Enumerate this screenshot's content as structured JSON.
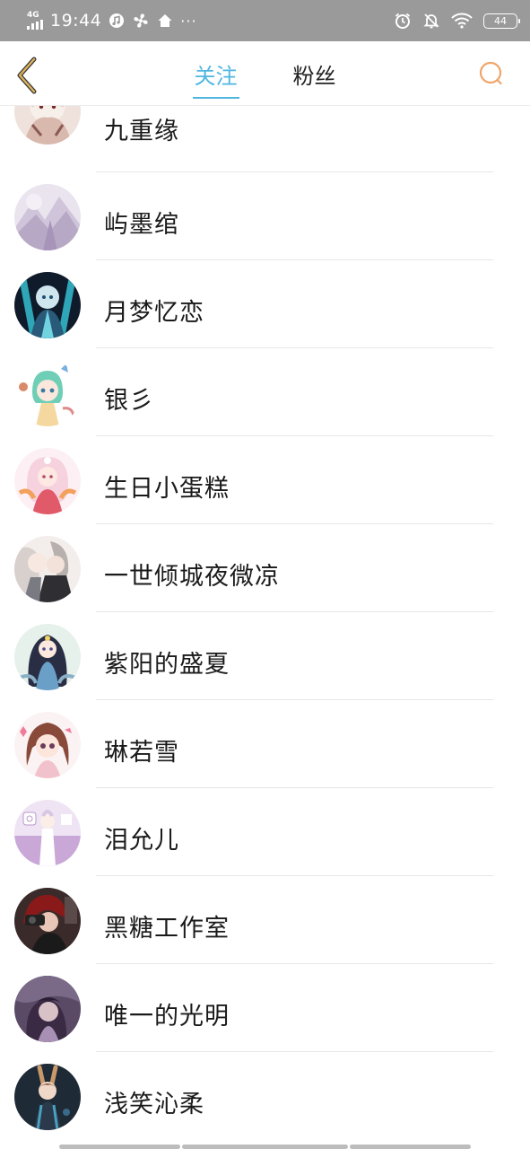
{
  "status_bar": {
    "network": "4G",
    "time": "19:44",
    "more": "···",
    "battery": "44",
    "icons": [
      "signal-icon",
      "music-icon",
      "fan-icon",
      "home-icon",
      "alarm-icon",
      "mute-icon",
      "wifi-icon",
      "battery-icon"
    ]
  },
  "header": {
    "back_icon": "chevron-left-icon",
    "tabs": [
      {
        "label": "关注",
        "active": true
      },
      {
        "label": "粉丝",
        "active": false
      }
    ],
    "search_icon": "search-icon",
    "accent_color": "#4fb6e2",
    "back_color": "#e0b35a",
    "search_color": "#f0a46a"
  },
  "list": {
    "items": [
      {
        "name": "九重缘"
      },
      {
        "name": "屿墨绾"
      },
      {
        "name": "月梦忆恋"
      },
      {
        "name": "银彡"
      },
      {
        "name": "生日小蛋糕"
      },
      {
        "name": "一世倾城夜微凉"
      },
      {
        "name": "紫阳的盛夏"
      },
      {
        "name": "琳若雪"
      },
      {
        "name": "泪允儿"
      },
      {
        "name": "黑糖工作室"
      },
      {
        "name": "唯一的光明"
      },
      {
        "name": "浅笑沁柔"
      }
    ]
  }
}
